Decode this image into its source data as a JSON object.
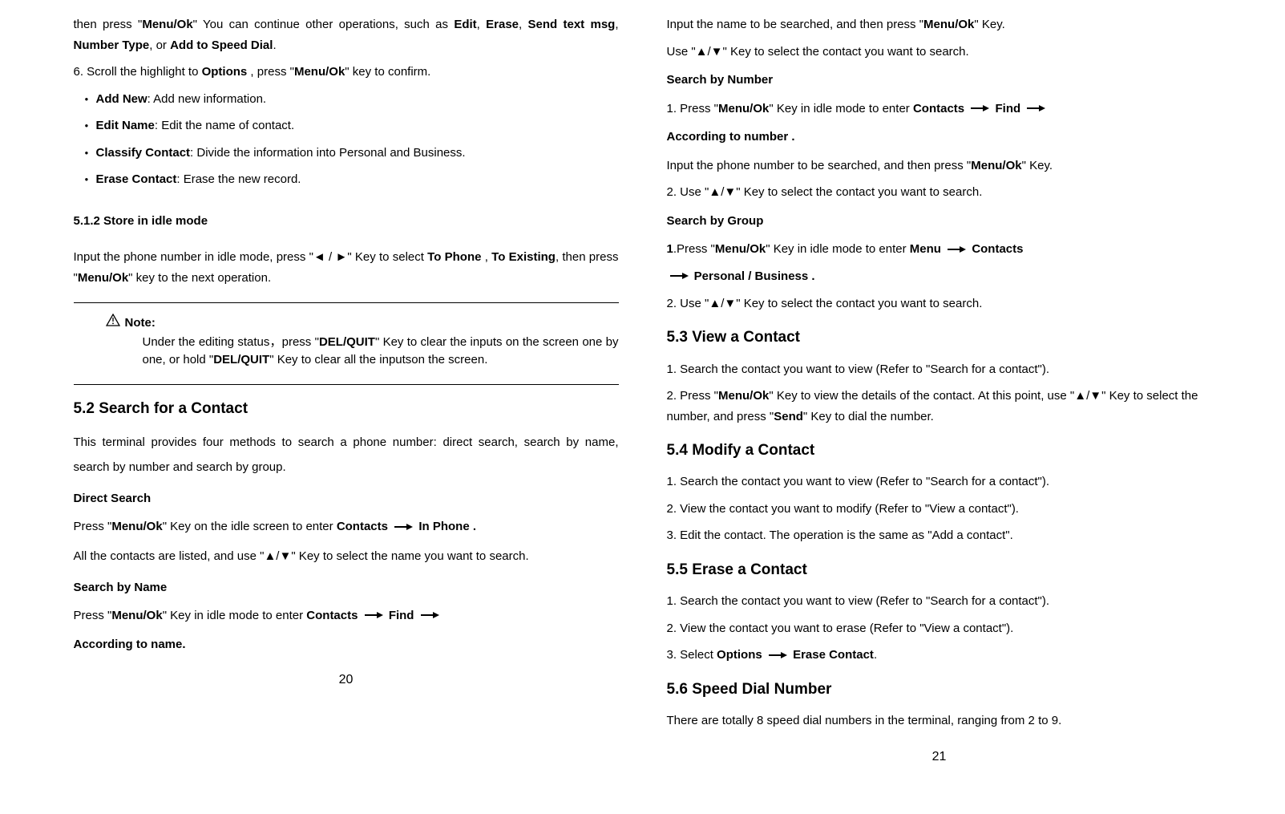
{
  "left": {
    "para1_a": "then press \"",
    "para1_b": "Menu/Ok",
    "para1_c": "\" You can continue other operations, such as ",
    "para1_d": "Edit",
    "para1_e": ", ",
    "para1_f": "Erase",
    "para1_g": ", ",
    "para1_h": "Send text msg",
    "para1_i": ", ",
    "para1_j": "Number Type",
    "para1_k": ", or ",
    "para1_l": "Add to Speed Dial",
    "para1_m": ".",
    "item6_a": "6. Scroll the highlight to ",
    "item6_b": "Options",
    "item6_c": " , press \"",
    "item6_d": "Menu/Ok",
    "item6_e": "\" key   to confirm.",
    "bullet1_a": "Add New",
    "bullet1_b": ": Add new information.",
    "bullet2_a": "Edit Name",
    "bullet2_b": ": Edit the name of contact.",
    "bullet3_a": "Classify Contact",
    "bullet3_b": ": Divide the information into Personal and Business.",
    "bullet4_a": "Erase Contact",
    "bullet4_b": ": Erase the new record.",
    "h512": "5.1.2 Store in idle mode",
    "idle1_a": "Input the phone number in idle mode, press \"◄ / ►\" Key to select ",
    "idle1_b": "To Phone",
    "idle1_c": " , ",
    "idle1_d": "To Existing",
    "idle1_e": ", then press \"",
    "idle1_f": "Menu/Ok",
    "idle1_g": "\" key to the next operation.",
    "note_label": "Note:",
    "note_a": "Under the editing status，press \"",
    "note_b": "DEL/QUIT",
    "note_c": "\" Key to clear the inputs on the screen one by one, or hold \"",
    "note_d": "DEL/QUIT",
    "note_e": "\" Key to clear all the inputson the screen.",
    "h52": "5.2 Search for a Contact",
    "s52_intro": "This terminal provides four methods to search a phone number: direct search, search by name, search by number and search by group.",
    "ds_head": "Direct Search",
    "ds_a": "Press \"",
    "ds_b": "Menu/Ok",
    "ds_c": "\" Key on the idle screen to enter ",
    "ds_d": "Contacts",
    "ds_e": " In Phone .",
    "ds_2": "All the contacts are listed, and use \"▲/▼\" Key to select the name you want to search.",
    "sbn_head": "Search by Name",
    "sbn_a": "Press \"",
    "sbn_b": "Menu/Ok",
    "sbn_c": "\" Key in idle mode to enter ",
    "sbn_d": "Contacts",
    "sbn_e": " Find",
    "sbn_f": "According to name.",
    "pagenum": "20"
  },
  "right": {
    "r1_a": "Input the name to be searched, and then press \"",
    "r1_b": "Menu/Ok",
    "r1_c": "\" Key.",
    "r2": "Use \"▲/▼\" Key to select the contact you want to search.",
    "sbnum_head": "Search by Number",
    "sbnum_a": "1. Press \"",
    "sbnum_b": "Menu/Ok",
    "sbnum_c": "\" Key in idle mode to enter ",
    "sbnum_d": "Contacts",
    "sbnum_e": " Find",
    "sbnum_f": "According to number .",
    "sbnum_2_a": "Input the phone number to be searched, and then press \"",
    "sbnum_2_b": "Menu/Ok",
    "sbnum_2_c": "\" Key.",
    "sbnum_3": "2. Use \"▲/▼\" Key to select the contact you want to search.",
    "sbg_head": "Search by Group",
    "sbg_a": "1",
    "sbg_b": ".Press \"",
    "sbg_c": "Menu/Ok",
    "sbg_d": "\" Key in idle mode to enter ",
    "sbg_e": "Menu",
    "sbg_f": " Contacts",
    "sbg_g": " Personal / Business .",
    "sbg_2": "2. Use \"▲/▼\" Key to select the contact you want to search.",
    "h53": "5.3 View a Contact",
    "s53_1": "1. Search the contact you want to view (Refer to \"Search for a contact\").",
    "s53_2a": "2. Press \"",
    "s53_2b": "Menu/Ok",
    "s53_2c": "\" Key  to view the details of the contact. At this point, use \"▲/▼\" Key to select the number, and press \"",
    "s53_2d": "Send",
    "s53_2e": "\" Key to dial the number.",
    "h54": "5.4 Modify a Contact",
    "s54_1": "1. Search the contact you want to view (Refer to \"Search for a contact\").",
    "s54_2": "2. View the contact you want to modify (Refer to \"View a contact\").",
    "s54_3": "3. Edit the contact. The operation is the same as \"Add a contact\".",
    "h55": "5.5 Erase a Contact",
    "s55_1": "1. Search the contact you want to view (Refer to \"Search for a contact\").",
    "s55_2": "2. View the contact you want to erase (Refer to \"View a contact\").",
    "s55_3a": "3. Select ",
    "s55_3b": "Options",
    "s55_3c": " Erase Contact",
    "s55_3d": ".",
    "h56": "5.6 Speed Dial Number",
    "s56_1": "There are totally 8 speed dial numbers in the terminal, ranging from 2 to 9.",
    "pagenum": "21"
  }
}
